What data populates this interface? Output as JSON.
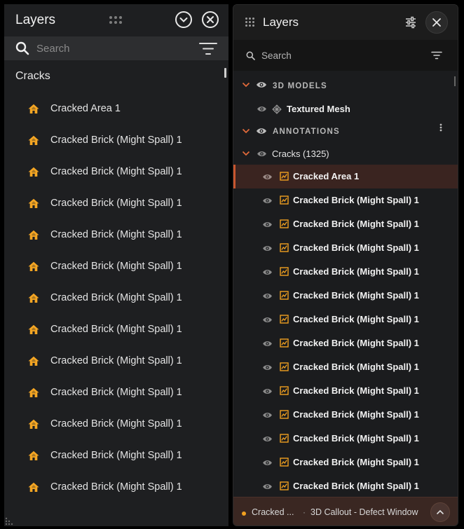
{
  "left_panel": {
    "title": "Layers",
    "search_placeholder": "Search",
    "group_label": "Cracks",
    "items": [
      {
        "label": "Cracked Area 1"
      },
      {
        "label": "Cracked Brick (Might Spall) 1"
      },
      {
        "label": "Cracked Brick (Might Spall) 1"
      },
      {
        "label": "Cracked Brick (Might Spall) 1"
      },
      {
        "label": "Cracked Brick (Might Spall) 1"
      },
      {
        "label": "Cracked Brick (Might Spall) 1"
      },
      {
        "label": "Cracked Brick (Might Spall) 1"
      },
      {
        "label": "Cracked Brick (Might Spall) 1"
      },
      {
        "label": "Cracked Brick (Might Spall) 1"
      },
      {
        "label": "Cracked Brick (Might Spall) 1"
      },
      {
        "label": "Cracked Brick (Might Spall) 1"
      },
      {
        "label": "Cracked Brick (Might Spall) 1"
      },
      {
        "label": "Cracked Brick (Might Spall) 1"
      }
    ]
  },
  "right_panel": {
    "title": "Layers",
    "search_placeholder": "Search",
    "sections": {
      "models_label": "3D MODELS",
      "models_item": "Textured Mesh",
      "annotations_label": "ANNOTATIONS",
      "group_label": "Cracks (1325)"
    },
    "items": [
      {
        "label": "Cracked Area 1",
        "selected": true
      },
      {
        "label": "Cracked Brick (Might Spall) 1"
      },
      {
        "label": "Cracked Brick (Might Spall) 1"
      },
      {
        "label": "Cracked Brick (Might Spall) 1"
      },
      {
        "label": "Cracked Brick (Might Spall) 1"
      },
      {
        "label": "Cracked Brick (Might Spall) 1"
      },
      {
        "label": "Cracked Brick (Might Spall) 1"
      },
      {
        "label": "Cracked Brick (Might Spall) 1"
      },
      {
        "label": "Cracked Brick (Might Spall) 1"
      },
      {
        "label": "Cracked Brick (Might Spall) 1"
      },
      {
        "label": "Cracked Brick (Might Spall) 1"
      },
      {
        "label": "Cracked Brick (Might Spall) 1"
      },
      {
        "label": "Cracked Brick (Might Spall) 1"
      },
      {
        "label": "Cracked Brick (Might Spall) 1"
      }
    ],
    "footer": {
      "name": "Cracked ...",
      "separator": "·",
      "type": "3D Callout - Defect Window"
    }
  },
  "colors": {
    "accent_orange": "#f0a020",
    "accent_red": "#c8552e",
    "selected_bg": "#3a2420"
  },
  "icons": {
    "item_left": "home-icon",
    "item_right": "polygon-area-icon",
    "visibility": "eye-icon"
  }
}
